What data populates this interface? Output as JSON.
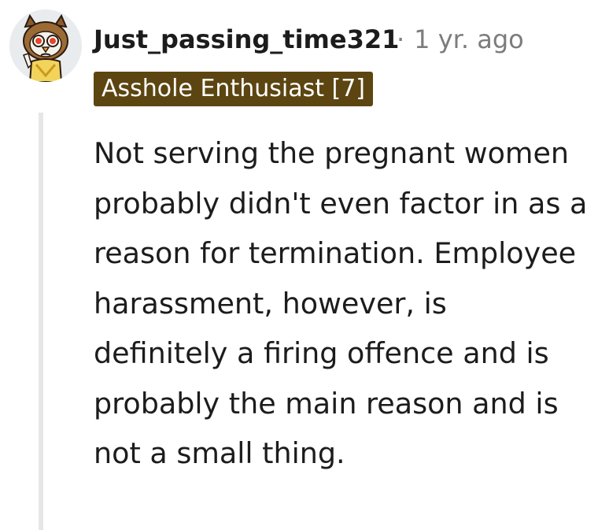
{
  "comment": {
    "username": "Just_passing_time321",
    "separator": "·",
    "timestamp": "1 yr. ago",
    "flair": "Asshole Enthusiast [7]",
    "body": "Not serving the pregnant women probably didn't even factor in as a reason for termination. Employee harassment, however, is definitely a firing offence and is probably the main reason and is not a small thing.",
    "avatar_icon": "owl-avatar-icon"
  },
  "colors": {
    "flair_bg": "#5c4511",
    "flair_text": "#ffffff",
    "username": "#1c1c1c",
    "meta": "#7c7c7c",
    "thread_line": "#e6e6e6",
    "avatar_bg": "#e9ecef"
  }
}
